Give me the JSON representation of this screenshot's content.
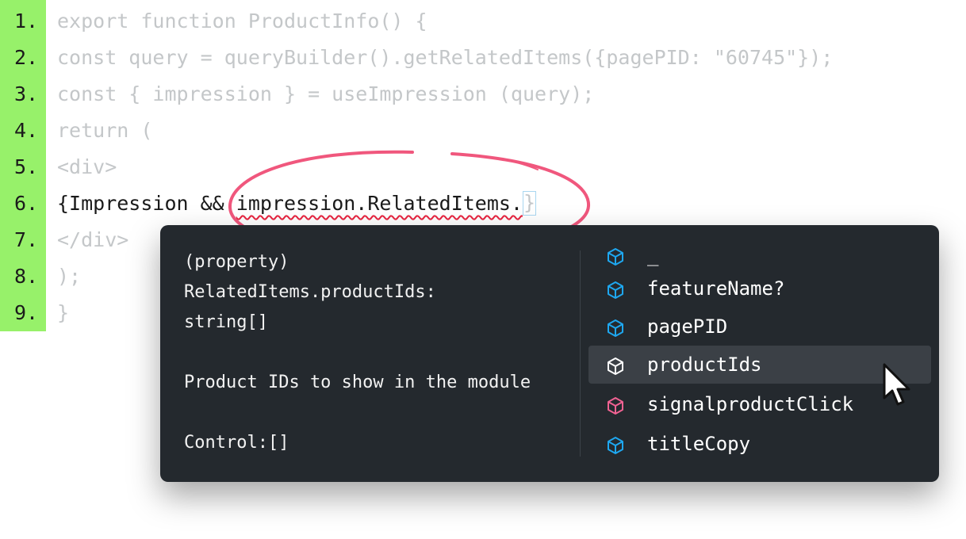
{
  "editor": {
    "line_numbers": [
      "1.",
      "2.",
      "3.",
      "4.",
      "5.",
      "6.",
      "7.",
      "8.",
      "9."
    ],
    "lines": [
      "export function ProductInfo() {",
      "const query = queryBuilder().getRelatedItems({pagePID: \"60745\"});",
      "const { impression } = useImpression (query);",
      "return (",
      "<div>",
      "",
      "</div>",
      ");",
      "}"
    ],
    "active_line": {
      "prefix": "{Impression && ",
      "squiggle": "impression.RelatedItems.",
      "caret": "}"
    }
  },
  "popup": {
    "doc_lines": [
      "(property)",
      "RelatedItems.productIds:",
      "string[]",
      "",
      "Product IDs to show in the module",
      "",
      "Control:[]"
    ],
    "items": [
      {
        "label": "_",
        "icon": "cube-icon",
        "color": "#1ea7f0"
      },
      {
        "label": "featureName?",
        "icon": "cube-icon",
        "color": "#1ea7f0"
      },
      {
        "label": "pagePID",
        "icon": "cube-icon",
        "color": "#1ea7f0"
      },
      {
        "label": "productIds",
        "icon": "cube-icon",
        "color": "#ffffff",
        "selected": true
      },
      {
        "label": "signalproductClick",
        "icon": "cube-icon",
        "color": "#f06292"
      },
      {
        "label": "titleCopy",
        "icon": "cube-icon",
        "color": "#1ea7f0"
      }
    ]
  },
  "colors": {
    "gutter": "#97f16a",
    "highlight_ellipse": "#f0577d",
    "squiggle": "#e8233f",
    "popup_bg": "#24292e"
  }
}
